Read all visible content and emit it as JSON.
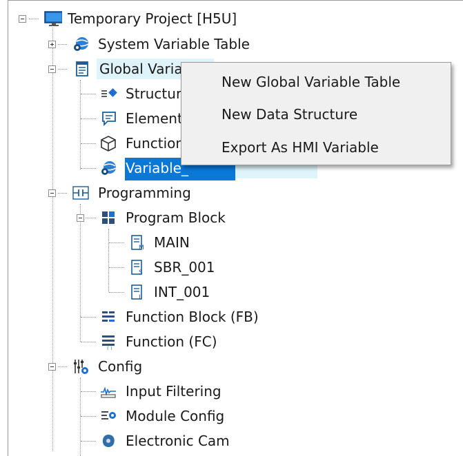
{
  "tree": {
    "root": {
      "label": "Temporary Project [H5U]",
      "icon": "monitor-icon"
    },
    "system_variable_table": {
      "label": "System Variable Table",
      "icon": "globe-gear-icon"
    },
    "global_variables": {
      "label": "Global Variables",
      "icon": "table-document-icon"
    },
    "structures": {
      "label": "Structures",
      "icon": "structure-icon"
    },
    "elements": {
      "label": "Elements",
      "icon": "speech-bubble-icon"
    },
    "functions": {
      "label": "Functions",
      "icon": "cube-icon"
    },
    "variable_selected": {
      "label": "Variable_",
      "icon": "globe-gear-icon"
    },
    "programming": {
      "label": "Programming",
      "icon": "ladder-contact-icon"
    },
    "program_block": {
      "label": "Program Block",
      "icon": "blocks-icon"
    },
    "main": {
      "label": "MAIN",
      "icon": "doc-m-icon",
      "badge": "M"
    },
    "sbr_001": {
      "label": "SBR_001",
      "icon": "doc-s-icon",
      "badge": "S"
    },
    "int_001": {
      "label": "INT_001",
      "icon": "doc-i-icon",
      "badge": "I"
    },
    "function_block": {
      "label": "Function Block (FB)",
      "icon": "fb-icon"
    },
    "function_fc": {
      "label": "Function (FC)",
      "icon": "fc-icon"
    },
    "config": {
      "label": "Config",
      "icon": "sliders-gear-icon"
    },
    "input_filtering": {
      "label": "Input Filtering",
      "icon": "signal-wave-icon"
    },
    "module_config": {
      "label": "Module Config",
      "icon": "list-gear-icon"
    },
    "electronic_cam": {
      "label": "Electronic Cam",
      "icon": "cam-icon"
    }
  },
  "context_menu": {
    "items": [
      {
        "label": "New Global Variable Table"
      },
      {
        "label": "New Data Structure"
      },
      {
        "label": "Export As HMI Variable"
      }
    ]
  },
  "colors": {
    "selection": "#0a78d7",
    "hover_row": "#dff3fb",
    "menu_bg": "#f0f0f0",
    "icon_blue": "#1c5d99"
  }
}
